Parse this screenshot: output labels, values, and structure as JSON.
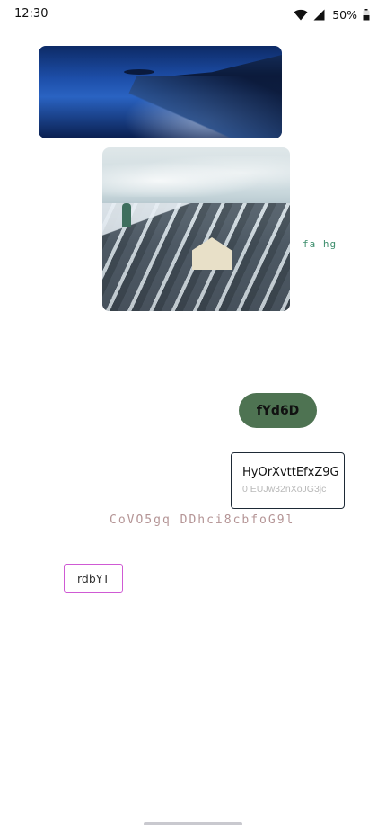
{
  "status_bar": {
    "time": "12:30",
    "battery_percent": "50%",
    "icons": [
      "wifi-icon",
      "signal-icon",
      "battery-icon"
    ]
  },
  "images": {
    "ocean": "ocean-coast-photo",
    "city": "snowy-city-rooftops-photo"
  },
  "caption_small": "fa hg",
  "pill_button": {
    "label": "fYd6D",
    "color": "#4e7352"
  },
  "card": {
    "title": "HyOrXvttEfxZ9G",
    "subtitle": "0 EUJw32nXoJG3jc"
  },
  "mono_line": "CoVO5gq DDhci8cbfoG9l",
  "outline_button": {
    "label": "rdbYT",
    "border_color": "#cf5ad4"
  }
}
